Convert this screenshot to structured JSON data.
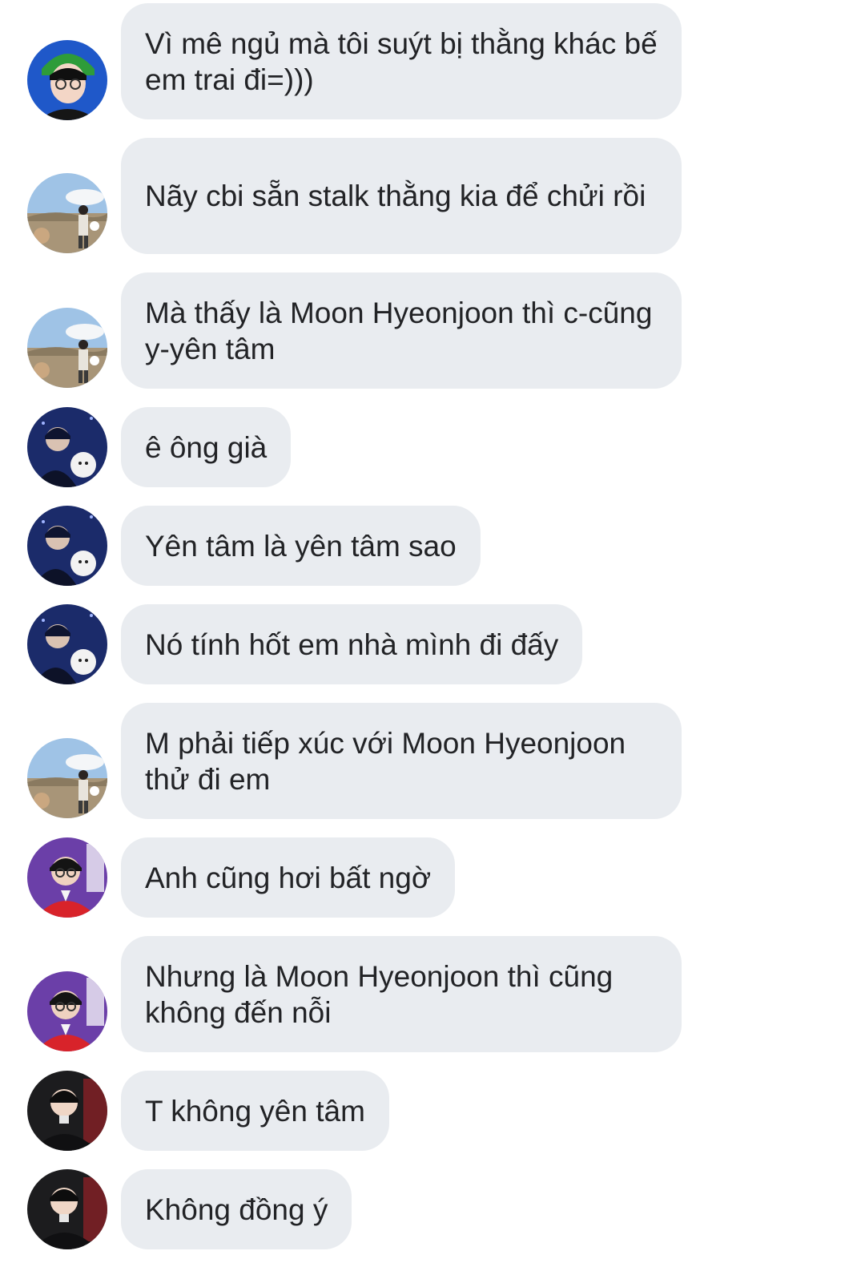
{
  "messages": [
    {
      "text": "Vì mê ngủ mà tôi suýt bị thằng khác bế em trai đi=)))",
      "avatar": "avatar-green-hat"
    },
    {
      "text": "Nãy cbi sẵn stalk thằng kia để chửi rồi",
      "avatar": "avatar-field"
    },
    {
      "text": "Mà thấy là Moon Hyeonjoon thì c-cũng y-yên tâm",
      "avatar": "avatar-field"
    },
    {
      "text": "ê ông già",
      "avatar": "avatar-blue-night"
    },
    {
      "text": "Yên tâm là yên tâm sao",
      "avatar": "avatar-blue-night"
    },
    {
      "text": "Nó tính hốt em nhà mình đi đấy",
      "avatar": "avatar-blue-night"
    },
    {
      "text": "M phải tiếp xúc với Moon Hyeonjoon thử đi em",
      "avatar": "avatar-field"
    },
    {
      "text": "Anh cũng hơi bất ngờ",
      "avatar": "avatar-purple-red"
    },
    {
      "text": "Nhưng là Moon Hyeonjoon thì cũng không đến nỗi",
      "avatar": "avatar-purple-red"
    },
    {
      "text": "T không yên tâm",
      "avatar": "avatar-dark-suit"
    },
    {
      "text": "Không đồng ý",
      "avatar": "avatar-dark-suit"
    }
  ],
  "colors": {
    "bubble_background": "#e9ecf0",
    "message_text": "#222326",
    "page_background": "#ffffff"
  }
}
